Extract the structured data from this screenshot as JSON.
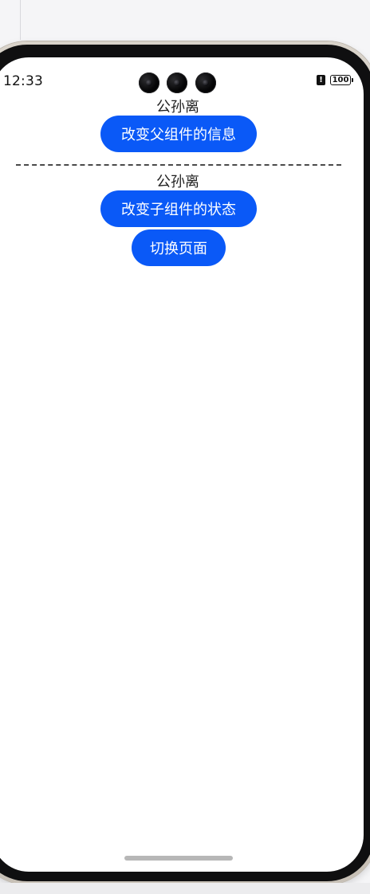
{
  "status_bar": {
    "time": "12:33",
    "alert_symbol": "!",
    "battery": "100",
    "icons": [
      "alert-icon",
      "battery-icon"
    ]
  },
  "parent_section": {
    "name": "公孙离",
    "button_label": "改变父组件的信息"
  },
  "child_section": {
    "name": "公孙离",
    "button_label": "改变子组件的状态"
  },
  "switch_page_label": "切换页面",
  "colors": {
    "button_background": "#0a59f7",
    "button_text": "#ffffff",
    "text": "#1f1f1f",
    "screen_background": "#ffffff"
  }
}
